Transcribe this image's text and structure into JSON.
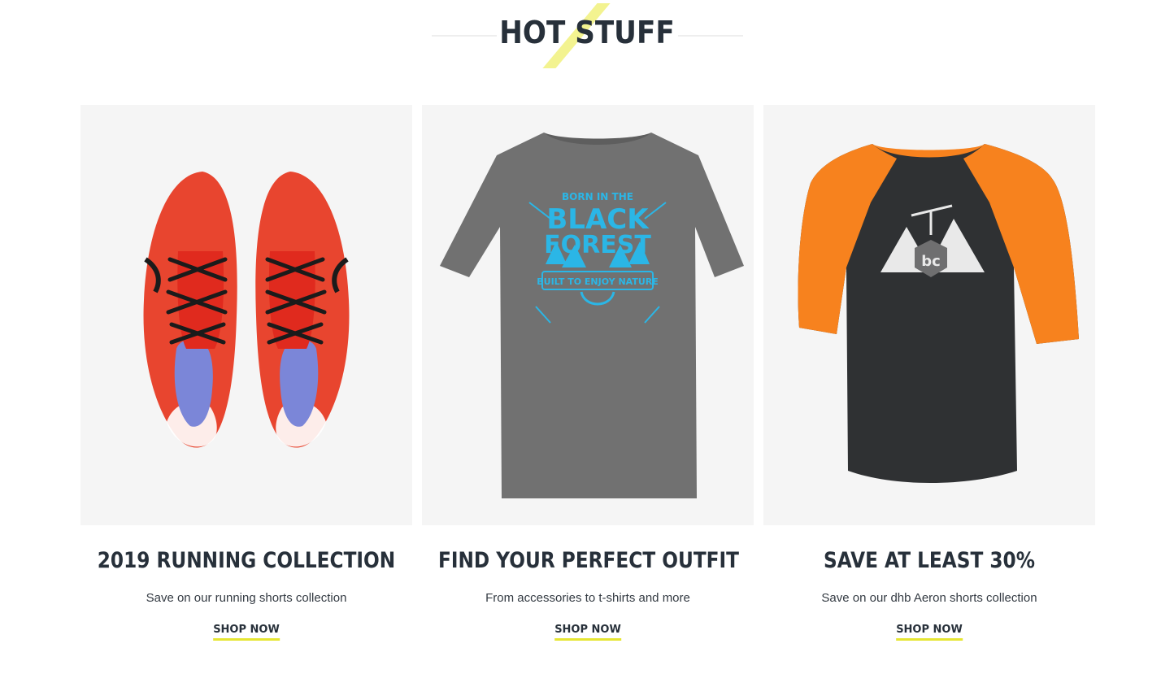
{
  "section": {
    "title": "HOT STUFF"
  },
  "cards": [
    {
      "title": "2019 RUNNING COLLECTION",
      "subtitle": "Save on our running shorts collection",
      "cta": "SHOP NOW",
      "image": "running-shoes-image"
    },
    {
      "title": "FIND YOUR PERFECT OUTFIT",
      "subtitle": "From accessories to t-shirts and more",
      "cta": "SHOP NOW",
      "image": "gray-tshirt-image",
      "print": {
        "line1": "BORN IN THE",
        "line2": "BLACK",
        "line3": "FOREST",
        "line4": "BUILT TO ENJOY NATURE"
      }
    },
    {
      "title": "SAVE AT LEAST 30%",
      "subtitle": "Save on our dhb Aeron shorts collection",
      "cta": "SHOP NOW",
      "image": "orange-raglan-tshirt-image",
      "print": {
        "logo": "bc"
      }
    }
  ],
  "colors": {
    "heading": "#27303a",
    "accent_underline": "#e6e632",
    "card_bg": "#f5f5f5",
    "shoe_red": "#e8452f",
    "tee_gray": "#707070",
    "print_blue": "#2bb6e6",
    "sleeve_orange": "#f7821e",
    "body_charcoal": "#2f3133"
  }
}
